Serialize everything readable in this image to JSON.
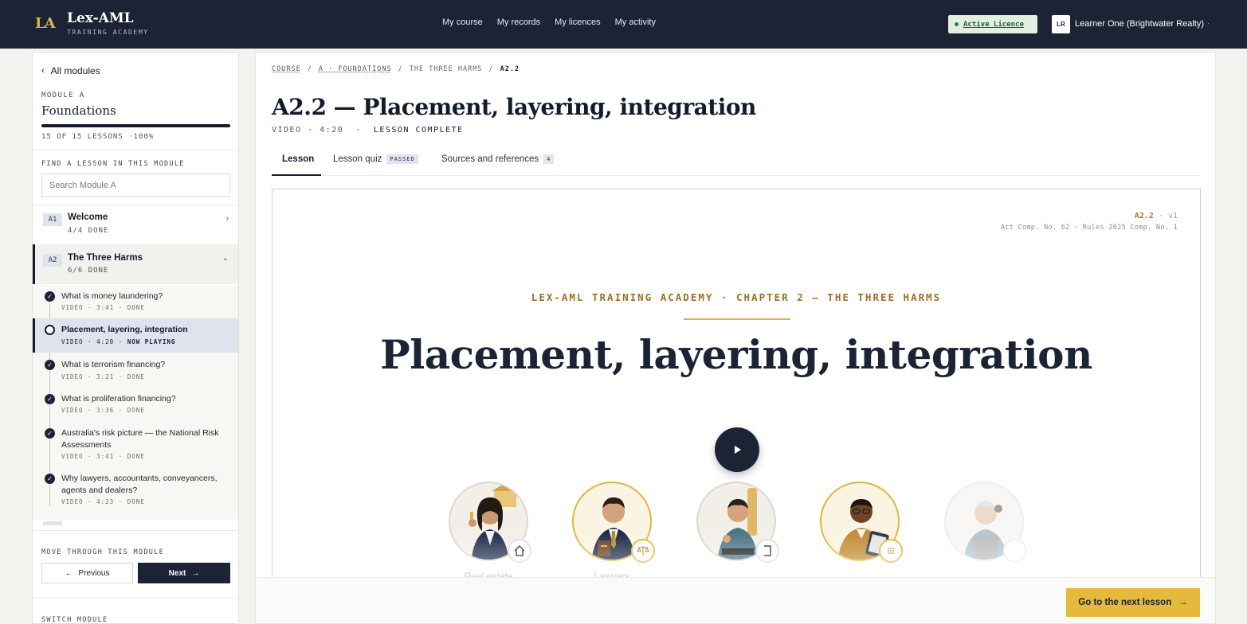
{
  "header": {
    "brand_mark": "LA",
    "brand_name": "Lex-AML",
    "brand_sub": "TRAINING ACADEMY",
    "nav": [
      "My course",
      "My records",
      "My licences",
      "My activity"
    ],
    "licence": "Active Licence",
    "avatar": "LR",
    "user": "Learner One (Brightwater Realty)",
    "user_caret": "·"
  },
  "sidebar": {
    "all_modules": "All modules",
    "module_label": "MODULE A",
    "module_title": "Foundations",
    "progress": 1.0,
    "progress_text": "15 OF 15 LESSONS",
    "progress_pct": "·100%",
    "find_label": "FIND A LESSON IN THIS MODULE",
    "search_placeholder": "Search Module A",
    "chapters": [
      {
        "code": "A1",
        "name": "Welcome",
        "done": "4/4 DONE",
        "arrow": "›"
      },
      {
        "code": "A2",
        "name": "The Three Harms",
        "done": "6/6 DONE",
        "arrow": "⌄"
      }
    ],
    "lessons": [
      {
        "title": "What is money laundering?",
        "meta": "VIDEO · 3:41 · DONE"
      },
      {
        "title": "Placement, layering, integration",
        "meta_prefix": "VIDEO · 4:20 · ",
        "meta_status": "NOW PLAYING"
      },
      {
        "title": "What is terrorism financing?",
        "meta": "VIDEO · 3:21 · DONE"
      },
      {
        "title": "What is proliferation financing?",
        "meta": "VIDEO · 3:36 · DONE"
      },
      {
        "title": "Australia's risk picture — the National Risk Assessments",
        "meta": "VIDEO · 3:41 · DONE"
      },
      {
        "title": "Why lawyers, accountants, conveyancers, agents and dealers?",
        "meta": "VIDEO · 4:23 · DONE"
      }
    ],
    "move_label": "MOVE THROUGH THIS MODULE",
    "prev": "Previous",
    "next": "Next",
    "switch_label": "SWITCH MODULE"
  },
  "main": {
    "breadcrumb": [
      "COURSE",
      "A · FOUNDATIONS",
      "THE THREE HARMS",
      "A2.2"
    ],
    "title": "A2.2 — Placement, layering, integration",
    "meta_left": "VIDEO · 4:20  ·  ",
    "meta_status": "LESSON COMPLETE",
    "tabs": [
      {
        "label": "Lesson"
      },
      {
        "label": "Lesson quiz",
        "badge": "PASSED"
      },
      {
        "label": "Sources and references",
        "badge": "4"
      }
    ],
    "video": {
      "code": "A2.2",
      "version": " · v1",
      "reference": "Act Comp. No. 62 · Rules 2025 Comp. No. 1",
      "kicker": "LEX-AML TRAINING ACADEMY · CHAPTER 2 — THE THREE HARMS",
      "title": "Placement, layering, integration",
      "personas": [
        "Real estate",
        "Lawyers"
      ]
    },
    "next_lesson": "Go to the next lesson",
    "colors": {
      "navy": "#1b2335",
      "gold": "#e5b93b",
      "accent_text": "#9a7124"
    }
  }
}
